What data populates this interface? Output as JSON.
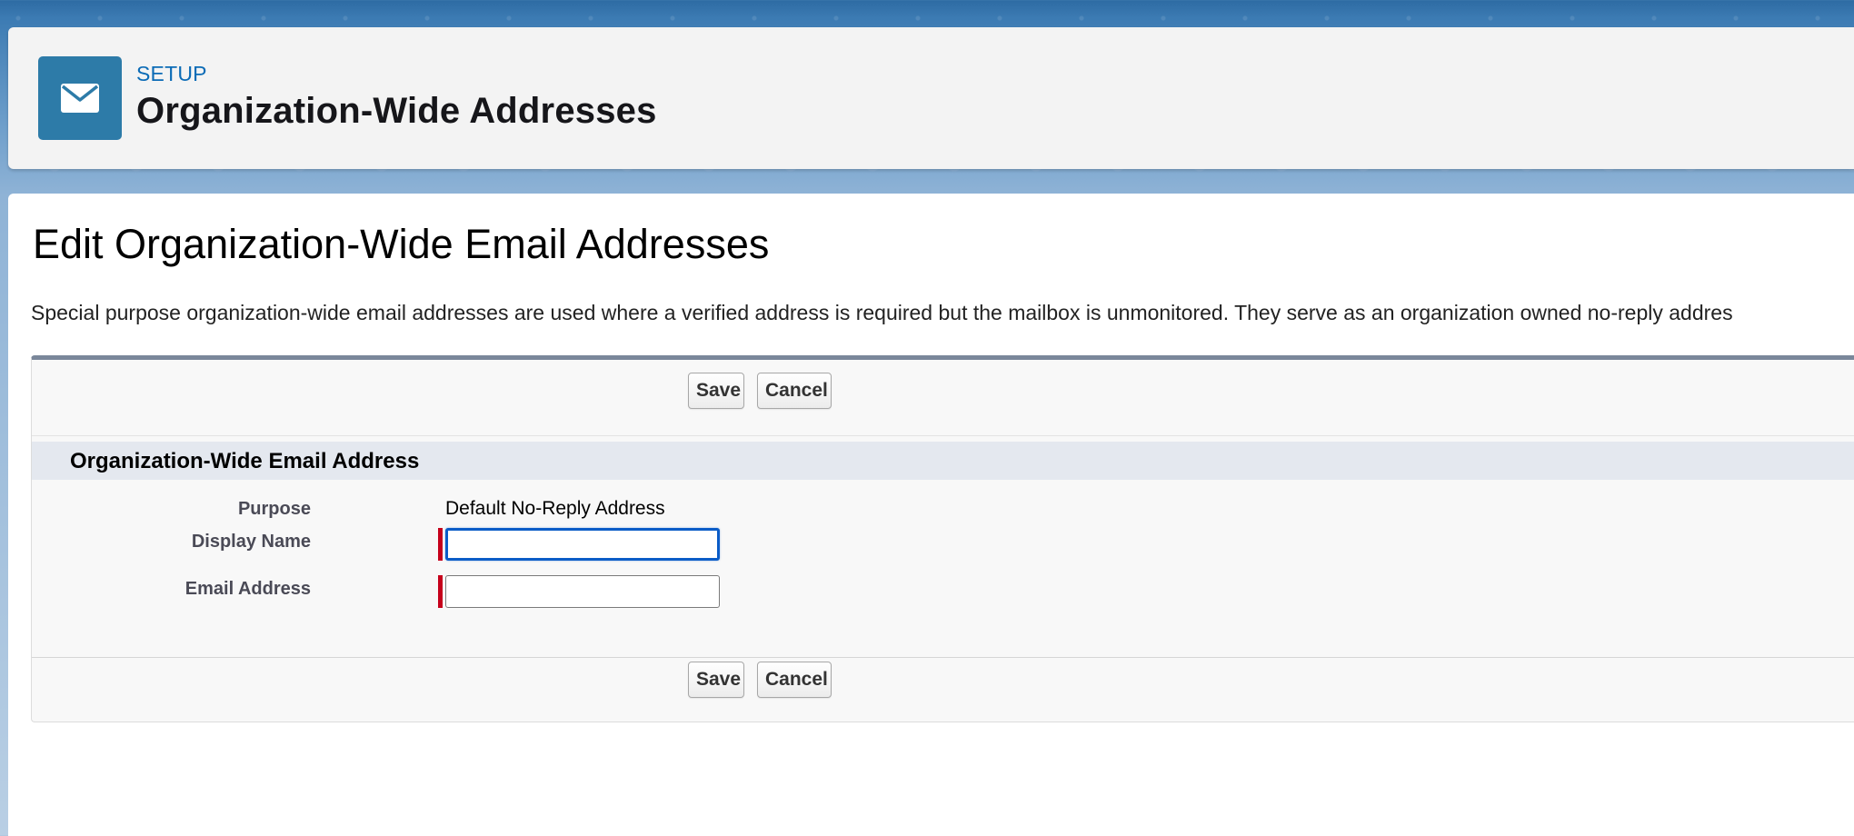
{
  "header": {
    "eyebrow": "SETUP",
    "title": "Organization-Wide Addresses",
    "icon": "envelope-icon"
  },
  "main": {
    "title": "Edit Organization-Wide Email Addresses",
    "intro": "Special purpose organization-wide email addresses are used where a verified address is required but the mailbox is unmonitored. They serve as an organization owned no-reply addres"
  },
  "buttons": {
    "save_label": "Save",
    "cancel_label": "Cancel"
  },
  "section": {
    "title": "Organization-Wide Email Address",
    "fields": [
      {
        "label": "Purpose",
        "value": "Default No-Reply Address"
      },
      {
        "label": "Display Name",
        "value": "",
        "required": true,
        "focused": true
      },
      {
        "label": "Email Address",
        "value": "",
        "required": true
      }
    ]
  },
  "colors": {
    "accent": "#0b6bb6",
    "icon_bg": "#2d7ba8",
    "required": "#c6001b",
    "focus": "#0b5cc7"
  }
}
